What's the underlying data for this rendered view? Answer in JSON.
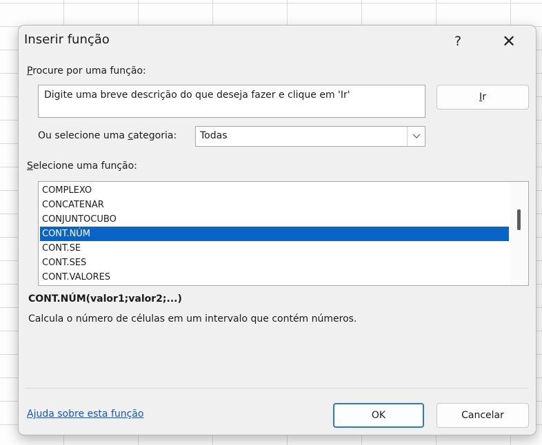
{
  "dialog": {
    "title": "Inserir função",
    "help_label": "?",
    "close_label": "✕"
  },
  "search": {
    "label_accel": "P",
    "label_rest": "rocure por uma função:",
    "value": "Digite uma breve descrição do que deseja fazer e clique em 'Ir'",
    "go_accel": "I",
    "go_rest": "r"
  },
  "category": {
    "label_pre": "Ou selecione uma ",
    "label_accel": "c",
    "label_post": "ategoria:",
    "selected": "Todas"
  },
  "function_list": {
    "label_accel": "S",
    "label_rest": "elecione uma função:",
    "items": [
      "COMPLEXO",
      "CONCATENAR",
      "CONJUNTOCUBO",
      "CONT.NÚM",
      "CONT.SE",
      "CONT.SES",
      "CONT.VALORES"
    ],
    "selected_index": 3
  },
  "details": {
    "signature": "CONT.NÚM(valor1;valor2;...)",
    "description": "Calcula o número de células em um intervalo que contém números."
  },
  "footer": {
    "help_link": "Ajuda sobre esta função",
    "ok_label": "OK",
    "cancel_label": "Cancelar"
  },
  "colors": {
    "selection": "#0a64c8",
    "link": "#1155cc",
    "default_button_border": "#2a78d2"
  },
  "icons": {
    "dropdown": "chevron-down-icon"
  }
}
